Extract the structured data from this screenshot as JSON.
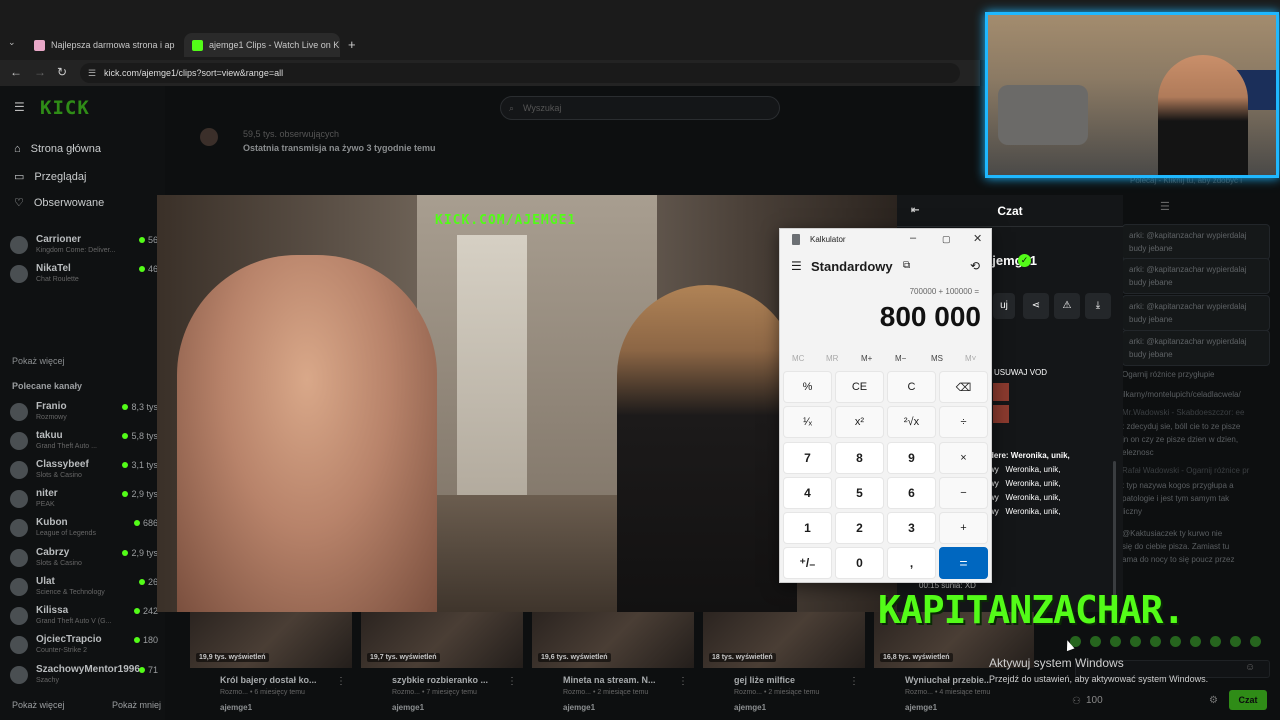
{
  "browser": {
    "tabs": [
      {
        "title": "Najlepsza darmowa strona i ap",
        "active": false
      },
      {
        "title": "ajemge1 Clips - Watch Live on K",
        "active": true
      }
    ],
    "url": "kick.com/ajemge1/clips?sort=view&range=all"
  },
  "kick": {
    "logo": "KICK",
    "search_placeholder": "Wyszukaj",
    "nav": [
      "Strona główna",
      "Przeglądaj",
      "Obserwowane"
    ],
    "followed": [
      {
        "name": "Carrioner",
        "category": "Kingdom Come: Deliver...",
        "viewers": "56"
      },
      {
        "name": "NikaTel",
        "category": "Chat Roulette",
        "viewers": "46"
      }
    ],
    "show_more": "Pokaż więcej",
    "recommended_title": "Polecane kanały",
    "recommended": [
      {
        "name": "Franio",
        "category": "Rozmowy",
        "viewers": "8,3 tys"
      },
      {
        "name": "takuu",
        "category": "Grand Theft Auto ...",
        "viewers": "5,8 tys"
      },
      {
        "name": "Classybeef",
        "category": "Slots & Casino",
        "viewers": "3,1 tys"
      },
      {
        "name": "niter",
        "category": "PEAK",
        "viewers": "2,9 tys"
      },
      {
        "name": "Kubon",
        "category": "League of Legends",
        "viewers": "686"
      },
      {
        "name": "Cabrzy",
        "category": "Slots & Casino",
        "viewers": "2,9 tys"
      },
      {
        "name": "Ulat",
        "category": "Science & Technology",
        "viewers": "26"
      },
      {
        "name": "Kilissa",
        "category": "Grand Theft Auto V (G...",
        "viewers": "242"
      },
      {
        "name": "OjciecTrapcio",
        "category": "Counter-Strike 2",
        "viewers": "180"
      },
      {
        "name": "SzachowyMentor1996",
        "category": "Szachy",
        "viewers": "71"
      }
    ],
    "sidebar_footer": {
      "left": "Pokaż więcej",
      "right": "Pokaż mniej"
    },
    "channel_followers": "59,5 tys. obserwujących",
    "last_stream": "Ostatnia transmisja na żywo 3 tygodnie temu",
    "channel_name": "ajemge1",
    "follow_label": "uj"
  },
  "video": {
    "watermark": "KICK.COM/AJEMGE1"
  },
  "overlay": {
    "name": "KAPITANZACHAR."
  },
  "chat": {
    "title": "Czat",
    "top_notice": "Polecaj - Kliknij tu, aby zdobyć i",
    "bubbles": [
      "arki: @kapitanzachar wypierdalaj budy jebane",
      "arki: @kapitanzachar wypierdalaj budy jebane",
      "arki: @kapitanzachar wypierdalaj budy jebane",
      "arki: @kapitanzachar wypierdalaj budy jebane"
    ],
    "right_msgs": [
      "Ogarnij różnice przygłupie",
      "ilkarny/montelupich/celadlacwela/",
      "Mr.Wadowski - Skabdoeszczor: ee",
      ": zdecyduj sie, bóll cie to ze pisze",
      "jn on czy ze pisze dzien w dzien,",
      "eleznosc",
      "Rafał Wadowski - Ogarnij różnice pr",
      ": typ nazywa kogos przygłupa a",
      "patologie i jest tym samym tak",
      "liczny",
      "@Kaktusiaczek ty kurwo nie",
      "się do ciebie pisza. Zamiast tu",
      "ama do nocy to się poucz przez"
    ],
    "inner": {
      "usuwaj": "USUWAJ VOD",
      "lines": [
        "dere: Weronika, unik,",
        "wy   Weronika, unik,",
        "wy   Weronika, unik,",
        "wy   Weronika, unik,",
        "wy   Weronika, unik,"
      ],
      "last": "00:15 sunia: XD"
    },
    "points": "100",
    "send": "Czat"
  },
  "calculator": {
    "app_title": "Kalkulator",
    "mode": "Standardowy",
    "expression": "700000 + 100000 =",
    "display": "800 000",
    "memory": [
      "MC",
      "MR",
      "M+",
      "M−",
      "MS",
      "M˅"
    ],
    "keys": [
      [
        "%",
        "CE",
        "C",
        "⌫"
      ],
      [
        "¹⁄ₓ",
        "x²",
        "²√x",
        "÷"
      ],
      [
        "7",
        "8",
        "9",
        "×"
      ],
      [
        "4",
        "5",
        "6",
        "−"
      ],
      [
        "1",
        "2",
        "3",
        "+"
      ],
      [
        "⁺/₋",
        "0",
        ",",
        "="
      ]
    ]
  },
  "clips": [
    {
      "views": "19,9 tys. wyświetleń",
      "title": "Król bajery dostał ko...",
      "sub": "Rozmo... • 6 miesięcy temu",
      "channel": "ajemge1"
    },
    {
      "views": "19,7 tys. wyświetleń",
      "title": "szybkie rozbieranko ...",
      "sub": "Rozmo... • 7 miesięcy temu",
      "channel": "ajemge1"
    },
    {
      "views": "19,6 tys. wyświetleń",
      "title": "Mineta na stream. N...",
      "sub": "Rozmo... • 2 miesiące temu",
      "channel": "ajemge1"
    },
    {
      "views": "18 tys. wyświetleń",
      "title": "gej liże milfice",
      "sub": "Rozmo... • 2 miesiące temu",
      "channel": "ajemge1"
    },
    {
      "views": "16,8 tys. wyświetleń",
      "title": "Wyniuchał przebie...",
      "sub": "Rozmo... • 4 miesiące temu",
      "channel": "ajemge1"
    }
  ],
  "windows_activation": {
    "title": "Aktywuj system Windows",
    "subtitle": "Przejdź do ustawień, aby aktywować system Windows."
  },
  "colors": {
    "kick_green": "#53fc18",
    "calc_accent": "#0067c0",
    "cam_border": "#1fb8ff"
  }
}
